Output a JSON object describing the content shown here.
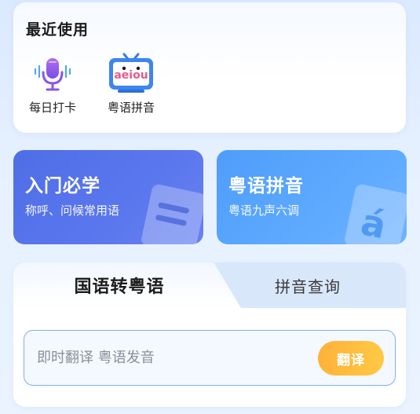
{
  "recent": {
    "title": "最近使用",
    "items": [
      {
        "label": "每日打卡",
        "icon": "microphone-icon"
      },
      {
        "label": "粤语拼音",
        "icon": "vowel-tv-icon",
        "icon_text": "aeiou"
      }
    ]
  },
  "features": [
    {
      "title": "入门必学",
      "subtitle": "称呼、问候常用语",
      "icon": "document-icon",
      "color": "#5a77ee"
    },
    {
      "title": "粤语拼音",
      "subtitle": "粤语九声六调",
      "icon": "accent-letter-icon",
      "icon_text": "á",
      "color": "#5eaaff"
    }
  ],
  "translate": {
    "tabs": [
      {
        "label": "国语转粤语",
        "active": true
      },
      {
        "label": "拼音查询",
        "active": false
      }
    ],
    "input": {
      "placeholder": "即时翻译 粤语发音",
      "value": ""
    },
    "button_label": "翻译",
    "button_color": "#ffb13a",
    "border_color": "#7fb0f0"
  }
}
